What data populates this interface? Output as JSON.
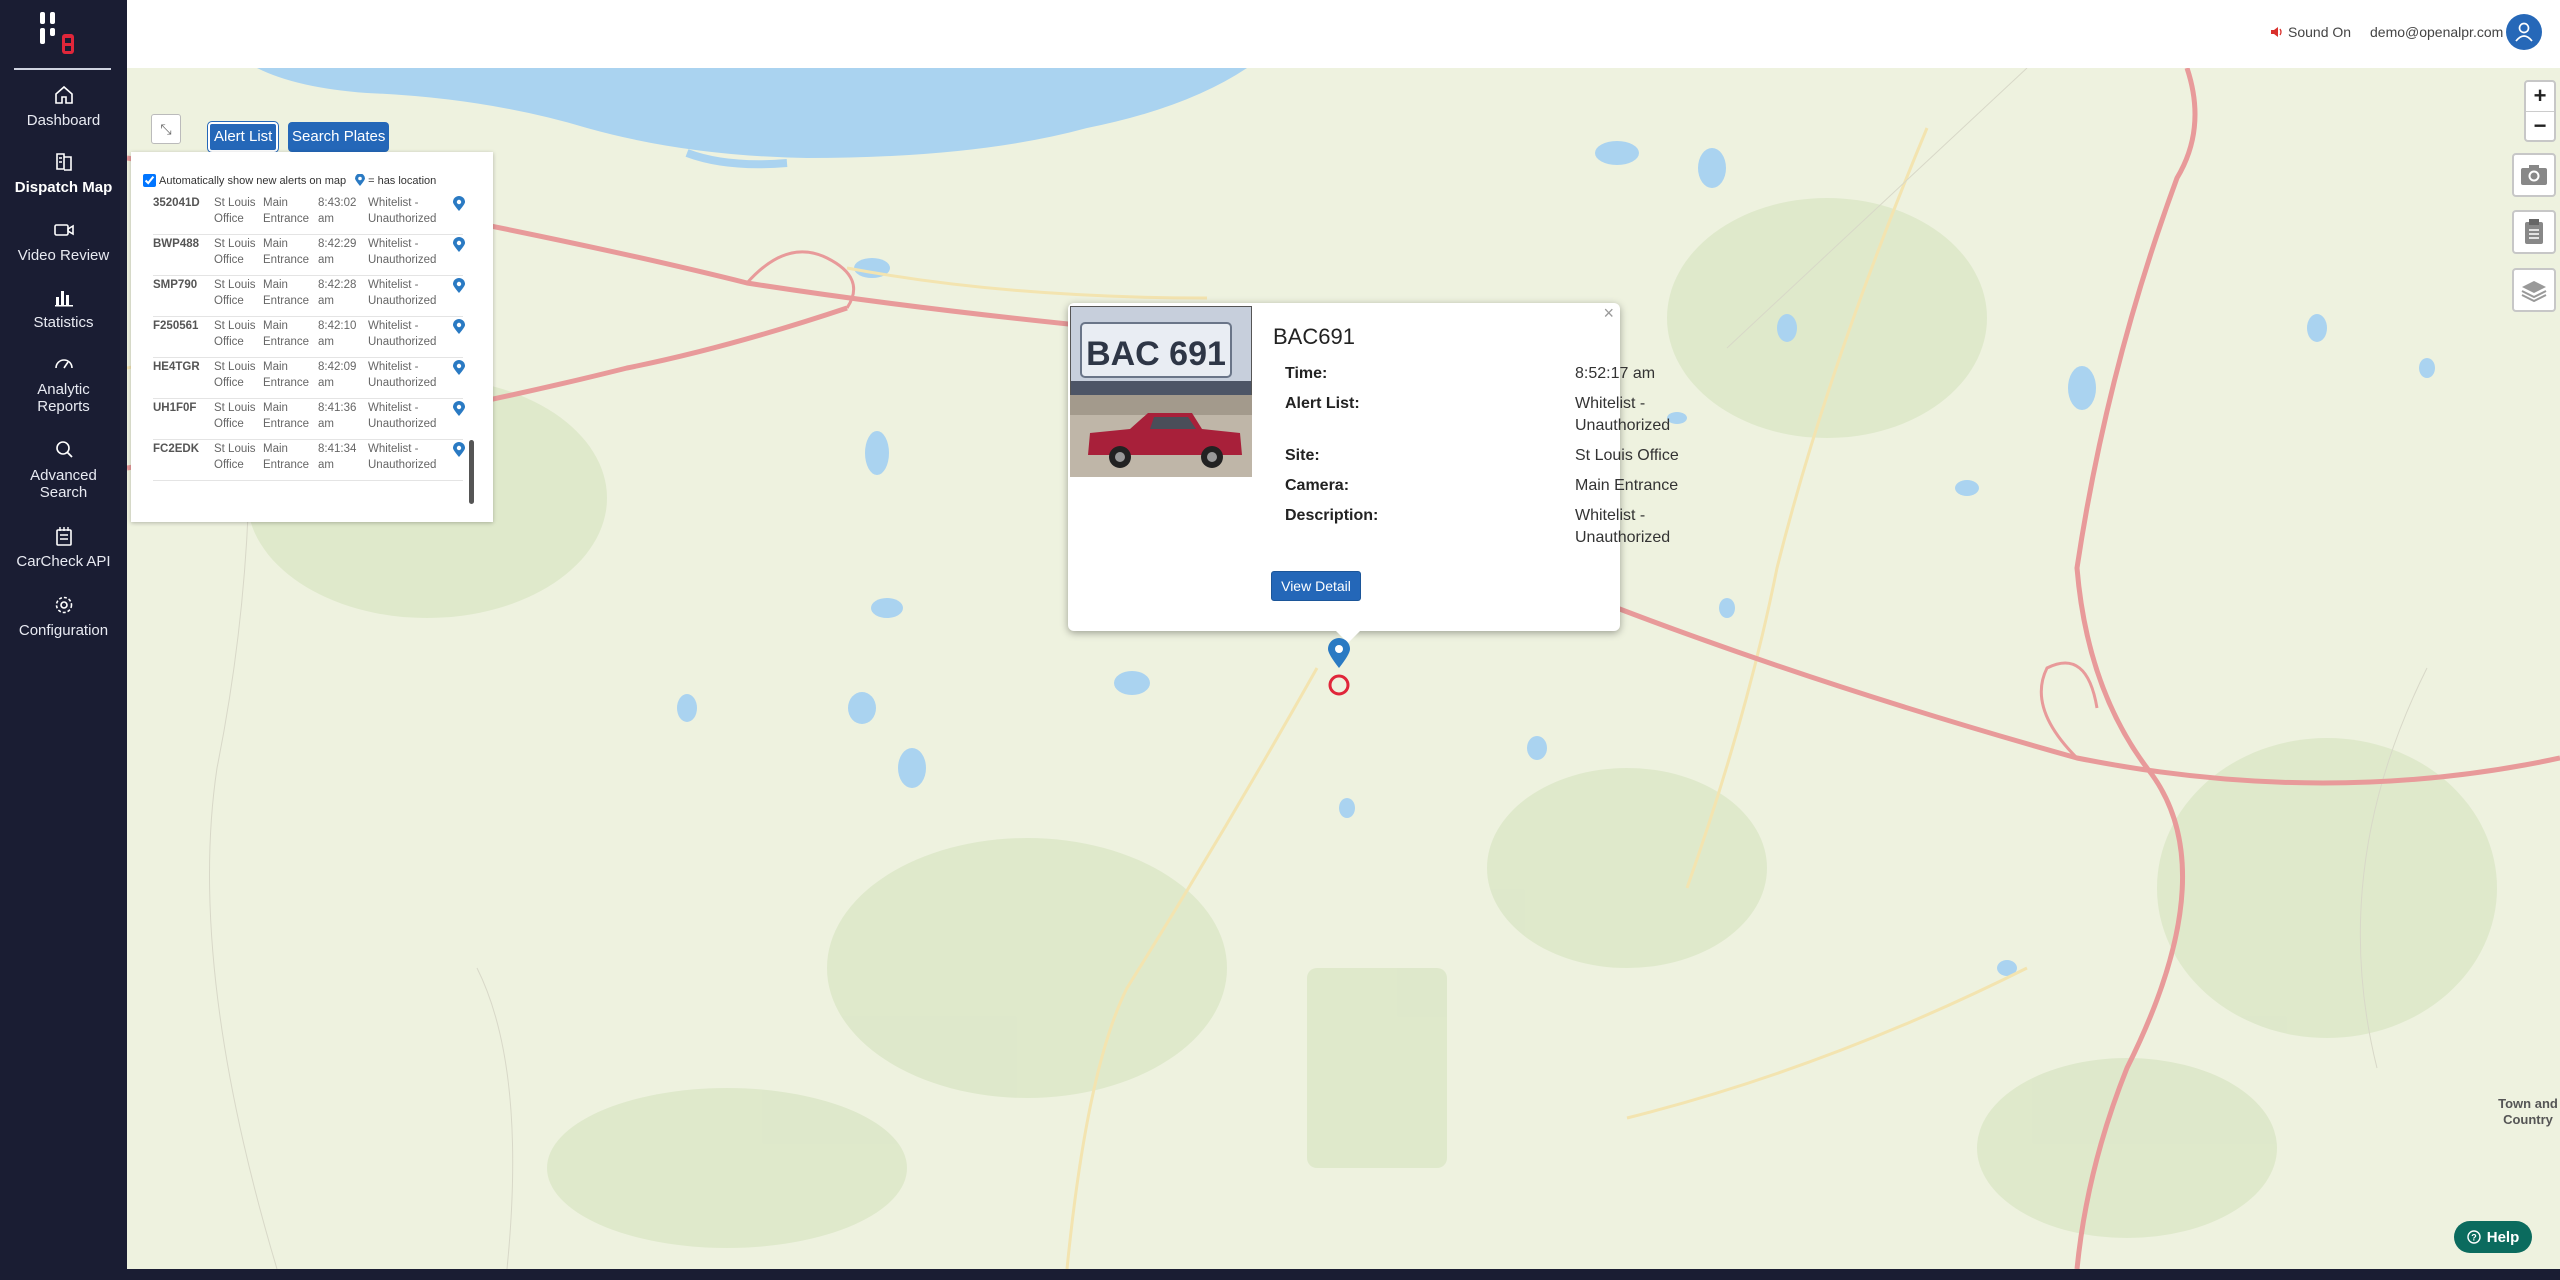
{
  "sidebar": {
    "items": [
      {
        "label": "Dashboard",
        "icon": "home-icon"
      },
      {
        "label": "Dispatch Map",
        "icon": "map-icon",
        "active": true
      },
      {
        "label": "Video Review",
        "icon": "video-icon"
      },
      {
        "label": "Statistics",
        "icon": "bar-chart-icon"
      },
      {
        "label": "Analytic Reports",
        "icon": "gauge-icon"
      },
      {
        "label": "Advanced Search",
        "icon": "search-icon"
      },
      {
        "label": "CarCheck API",
        "icon": "api-icon"
      },
      {
        "label": "Configuration",
        "icon": "gear-icon"
      }
    ]
  },
  "header": {
    "sound_label": "Sound On",
    "user_email": "demo@openalpr.com"
  },
  "panel": {
    "tabs": [
      "Alert List",
      "Search Plates"
    ],
    "active_tab": "Alert List",
    "auto_show_label": "Automatically show new alerts on map",
    "auto_show_checked": true,
    "has_location_label": "= has location",
    "alerts": [
      {
        "plate": "352041D",
        "site": "St Louis Office",
        "camera": "Main Entrance",
        "time": "8:43:02 am",
        "list": "Whitelist - Unauthorized"
      },
      {
        "plate": "BWP488",
        "site": "St Louis Office",
        "camera": "Main Entrance",
        "time": "8:42:29 am",
        "list": "Whitelist - Unauthorized"
      },
      {
        "plate": "SMP790",
        "site": "St Louis Office",
        "camera": "Main Entrance",
        "time": "8:42:28 am",
        "list": "Whitelist - Unauthorized"
      },
      {
        "plate": "F250561",
        "site": "St Louis Office",
        "camera": "Main Entrance",
        "time": "8:42:10 am",
        "list": "Whitelist - Unauthorized"
      },
      {
        "plate": "HE4TGR",
        "site": "St Louis Office",
        "camera": "Main Entrance",
        "time": "8:42:09 am",
        "list": "Whitelist - Unauthorized"
      },
      {
        "plate": "UH1F0F",
        "site": "St Louis Office",
        "camera": "Main Entrance",
        "time": "8:41:36 am",
        "list": "Whitelist - Unauthorized"
      },
      {
        "plate": "FC2EDK",
        "site": "St Louis Office",
        "camera": "Main Entrance",
        "time": "8:41:34 am",
        "list": "Whitelist - Unauthorized"
      }
    ]
  },
  "popup": {
    "plate": "BAC691",
    "plate_image_text": "BAC 691",
    "fields": {
      "time_label": "Time:",
      "time_value": "8:52:17 am",
      "alert_list_label": "Alert List:",
      "alert_list_value": "Whitelist - Unauthorized",
      "site_label": "Site:",
      "site_value": "St Louis Office",
      "camera_label": "Camera:",
      "camera_value": "Main Entrance",
      "description_label": "Description:",
      "description_value": "Whitelist - Unauthorized"
    },
    "view_detail_label": "View Detail",
    "close_label": "×"
  },
  "map": {
    "zoom_in": "+",
    "zoom_out": "−",
    "town_label": "Town and Country"
  },
  "help_label": "Help",
  "colors": {
    "sidebar_bg": "#1a1d33",
    "accent_blue": "#2467b8",
    "help_green": "#0b6b5e",
    "map_land": "#eef2df",
    "map_water": "#aad3f0",
    "highway": "#e89a9a",
    "alert_red": "#e0263a"
  }
}
